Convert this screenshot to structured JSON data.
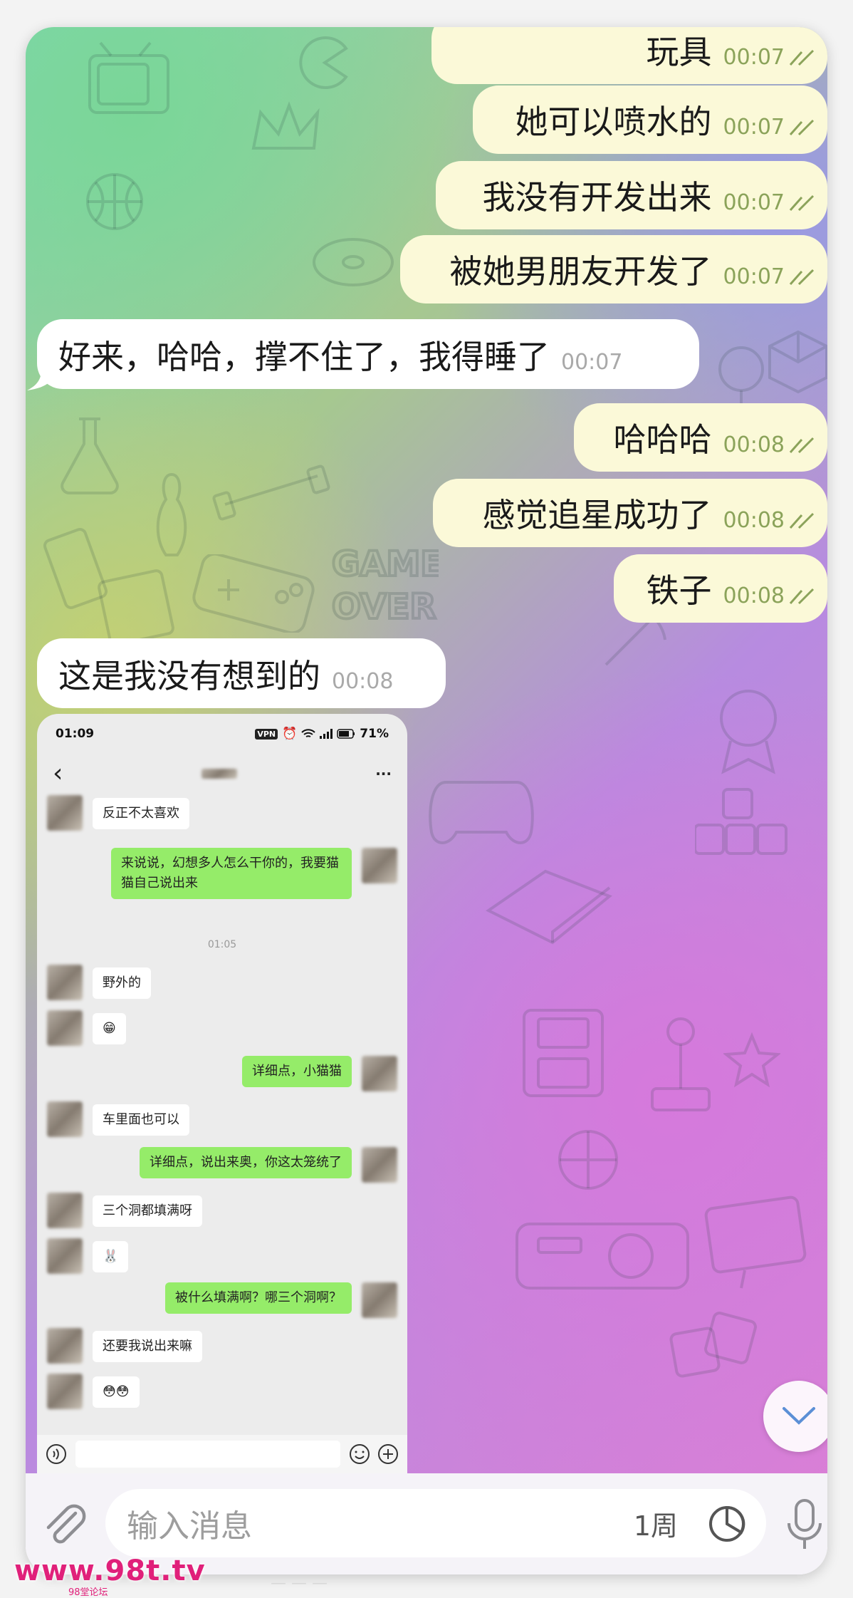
{
  "messages": [
    {
      "text": "玩具",
      "time": "00:07",
      "dir": "out"
    },
    {
      "text": "她可以喷水的",
      "time": "00:07",
      "dir": "out"
    },
    {
      "text": "我没有开发出来",
      "time": "00:07",
      "dir": "out"
    },
    {
      "text": "被她男朋友开发了",
      "time": "00:07",
      "dir": "out"
    },
    {
      "text": "好来，哈哈，撑不住了，我得睡了",
      "time": "00:07",
      "dir": "in"
    },
    {
      "text": "哈哈哈",
      "time": "00:08",
      "dir": "out"
    },
    {
      "text": "感觉追星成功了",
      "time": "00:08",
      "dir": "out"
    },
    {
      "text": "铁子",
      "time": "00:08",
      "dir": "out"
    },
    {
      "text": "这是我没有想到的",
      "time": "00:08",
      "dir": "in"
    }
  ],
  "embedded_screenshot": {
    "status_time": "01:09",
    "status_icons": "VPN",
    "battery": "71%",
    "back_glyph": "‹",
    "more_glyph": "···",
    "timestamp": "01:05",
    "items": [
      {
        "side": "left",
        "text": "反正不太喜欢"
      },
      {
        "side": "right",
        "text": "来说说，幻想多人怎么干你的，我要猫猫自己说出来"
      },
      {
        "side": "left",
        "text": "野外的"
      },
      {
        "side": "left",
        "text": "😁"
      },
      {
        "side": "right",
        "text": "详细点，小猫猫"
      },
      {
        "side": "left",
        "text": "车里面也可以"
      },
      {
        "side": "right",
        "text": "详细点，说出来奥，你这太笼统了"
      },
      {
        "side": "left",
        "text": "三个洞都填满呀"
      },
      {
        "side": "left",
        "text": "🐰"
      },
      {
        "side": "right",
        "text": "被什么填满啊？哪三个洞啊？"
      },
      {
        "side": "left",
        "text": "还要我说出来嘛"
      },
      {
        "side": "left",
        "text": "😳😳"
      }
    ]
  },
  "composer": {
    "placeholder": "输入消息",
    "timer_label": "1周"
  },
  "watermark": {
    "text": "www.98t.tv",
    "sub": "98堂论坛"
  },
  "icons": {
    "attach": "paperclip-icon",
    "timer": "timer-icon",
    "mic": "microphone-icon",
    "scroll": "chevron-down-icon",
    "read": "double-check-icon"
  },
  "colors": {
    "outgoing_bubble": "#fbf9d8",
    "incoming_bubble": "#ffffff",
    "outgoing_time": "#8ba35a",
    "wechat_green": "#95ec69",
    "watermark": "#e0207a"
  }
}
